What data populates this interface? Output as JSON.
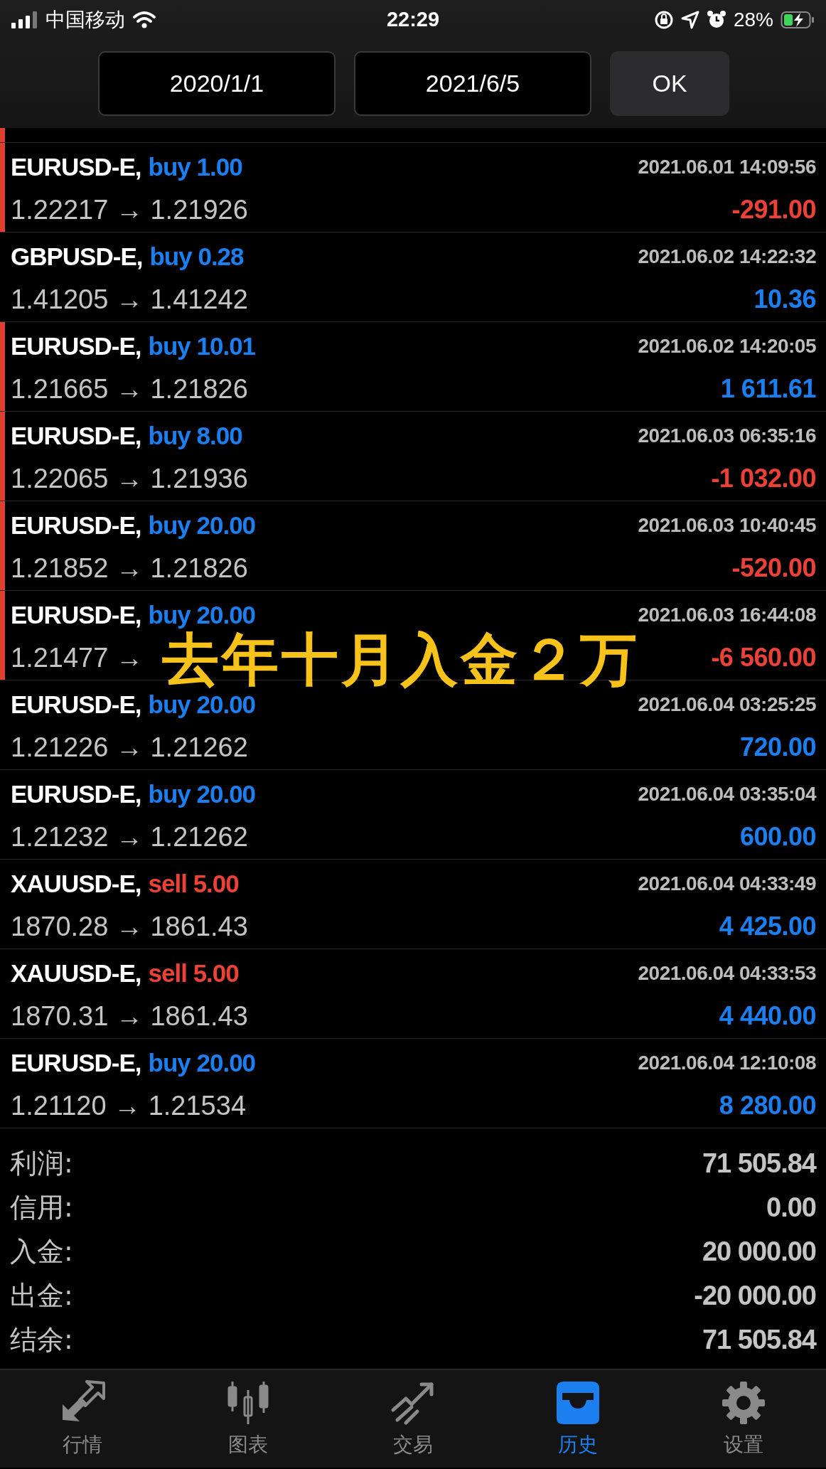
{
  "status_bar": {
    "carrier": "中国移动",
    "time": "22:29",
    "battery": "28%"
  },
  "date_range": {
    "from": "2020/1/1",
    "to": "2021/6/5",
    "ok": "OK"
  },
  "trades": [
    {
      "symbol": "EURUSD-E,",
      "selling": false,
      "action": "buy 1.00",
      "time": "2021.06.01 14:09:56",
      "prices": "1.22217 → 1.21926",
      "profit": "-291.00",
      "negative": true,
      "flagged": true
    },
    {
      "symbol": "GBPUSD-E,",
      "selling": false,
      "action": "buy 0.28",
      "time": "2021.06.02 14:22:32",
      "prices": "1.41205 → 1.41242",
      "profit": "10.36",
      "negative": false,
      "flagged": false
    },
    {
      "symbol": "EURUSD-E,",
      "selling": false,
      "action": "buy 10.01",
      "time": "2021.06.02 14:20:05",
      "prices": "1.21665 → 1.21826",
      "profit": "1 611.61",
      "negative": false,
      "flagged": true
    },
    {
      "symbol": "EURUSD-E,",
      "selling": false,
      "action": "buy 8.00",
      "time": "2021.06.03 06:35:16",
      "prices": "1.22065 → 1.21936",
      "profit": "-1 032.00",
      "negative": true,
      "flagged": true
    },
    {
      "symbol": "EURUSD-E,",
      "selling": false,
      "action": "buy 20.00",
      "time": "2021.06.03 10:40:45",
      "prices": "1.21852 → 1.21826",
      "profit": "-520.00",
      "negative": true,
      "flagged": true
    },
    {
      "symbol": "EURUSD-E,",
      "selling": false,
      "action": "buy 20.00",
      "time": "2021.06.03 16:44:08",
      "prices": "1.21477 →",
      "profit": "-6 560.00",
      "negative": true,
      "flagged": true
    },
    {
      "symbol": "EURUSD-E,",
      "selling": false,
      "action": "buy 20.00",
      "time": "2021.06.04 03:25:25",
      "prices": "1.21226 → 1.21262",
      "profit": "720.00",
      "negative": false,
      "flagged": false
    },
    {
      "symbol": "EURUSD-E,",
      "selling": false,
      "action": "buy 20.00",
      "time": "2021.06.04 03:35:04",
      "prices": "1.21232 → 1.21262",
      "profit": "600.00",
      "negative": false,
      "flagged": false
    },
    {
      "symbol": "XAUUSD-E,",
      "selling": true,
      "action": "sell 5.00",
      "time": "2021.06.04 04:33:49",
      "prices": "1870.28 → 1861.43",
      "profit": "4 425.00",
      "negative": false,
      "flagged": false
    },
    {
      "symbol": "XAUUSD-E,",
      "selling": true,
      "action": "sell 5.00",
      "time": "2021.06.04 04:33:53",
      "prices": "1870.31 → 1861.43",
      "profit": "4 440.00",
      "negative": false,
      "flagged": false
    },
    {
      "symbol": "EURUSD-E,",
      "selling": false,
      "action": "buy 20.00",
      "time": "2021.06.04 12:10:08",
      "prices": "1.21120 → 1.21534",
      "profit": "8 280.00",
      "negative": false,
      "flagged": false
    }
  ],
  "caption": "去年十月入金２万",
  "summary": [
    {
      "label": "利润:",
      "value": "71 505.84"
    },
    {
      "label": "信用:",
      "value": "0.00"
    },
    {
      "label": "入金:",
      "value": "20 000.00"
    },
    {
      "label": "出金:",
      "value": "-20 000.00"
    },
    {
      "label": "结余:",
      "value": "71 505.84"
    }
  ],
  "tabs": [
    {
      "label": "行情",
      "kind": "quotes",
      "selected": false
    },
    {
      "label": "图表",
      "kind": "chart",
      "selected": false
    },
    {
      "label": "交易",
      "kind": "trade",
      "selected": false
    },
    {
      "label": "历史",
      "kind": "history",
      "selected": true
    },
    {
      "label": "设置",
      "kind": "settings",
      "selected": false
    }
  ]
}
